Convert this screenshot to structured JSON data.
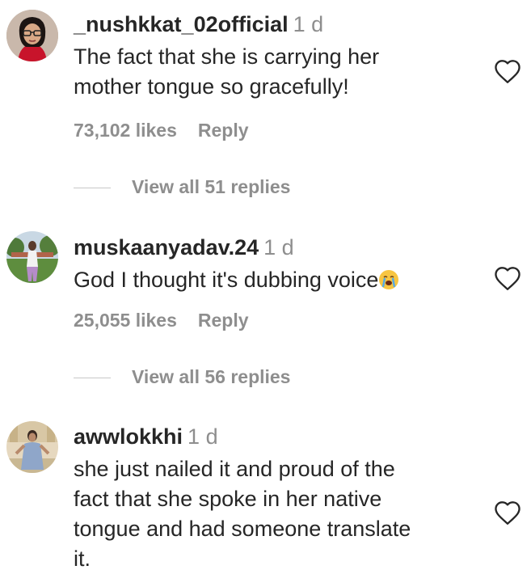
{
  "comments": [
    {
      "username": "_nushkkat_02official",
      "time": "1 d",
      "text_lines": [
        "The fact that she is carrying her",
        "mother tongue so gracefully!"
      ],
      "likes": "73,102 likes",
      "reply": "Reply",
      "view_replies": "View all 51 replies",
      "avatar_icon": "profile-photo-woman-glasses",
      "heart_icon": "heart-outline-icon"
    },
    {
      "username": "muskaanyadav.24",
      "time": "1 d",
      "text": "God I thought it's dubbing voice",
      "emoji": "loudly-crying-face",
      "likes": "25,055 likes",
      "reply": "Reply",
      "view_replies": "View all 56 replies",
      "avatar_icon": "profile-photo-outdoor-garden",
      "heart_icon": "heart-outline-icon"
    },
    {
      "username": "awwlokkhi",
      "time": "1 d",
      "text_lines": [
        "she just nailed it and proud of the",
        "fact that she spoke in her native",
        "tongue and had someone translate",
        "it."
      ],
      "avatar_icon": "profile-photo-woman-courtyard",
      "heart_icon": "heart-outline-icon"
    }
  ],
  "colors": {
    "text": "#262626",
    "muted": "#8e8e8e",
    "divider": "#c7c7c7"
  }
}
